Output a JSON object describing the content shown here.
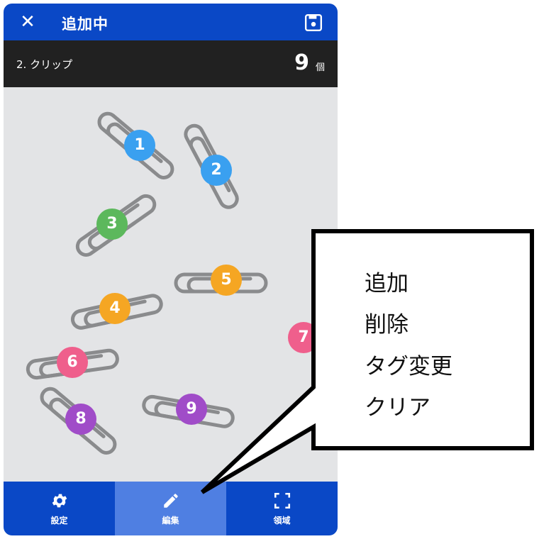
{
  "header": {
    "title": "追加中",
    "close_icon": "close-icon",
    "save_icon": "save-icon"
  },
  "subheader": {
    "category": "2. クリップ",
    "count": "9",
    "unit": "個"
  },
  "markers": [
    {
      "label": "1",
      "color": "#3aa0f0"
    },
    {
      "label": "2",
      "color": "#3aa0f0"
    },
    {
      "label": "3",
      "color": "#5cb85c"
    },
    {
      "label": "4",
      "color": "#f5a623"
    },
    {
      "label": "5",
      "color": "#f5a623"
    },
    {
      "label": "6",
      "color": "#ef5f8c"
    },
    {
      "label": "7",
      "color": "#ef5f8c"
    },
    {
      "label": "8",
      "color": "#a04cc8"
    },
    {
      "label": "9",
      "color": "#a04cc8"
    }
  ],
  "nav": {
    "settings": "設定",
    "edit": "編集",
    "area": "領域"
  },
  "popup_menu": [
    "追加",
    "削除",
    "タグ変更",
    "クリア"
  ]
}
